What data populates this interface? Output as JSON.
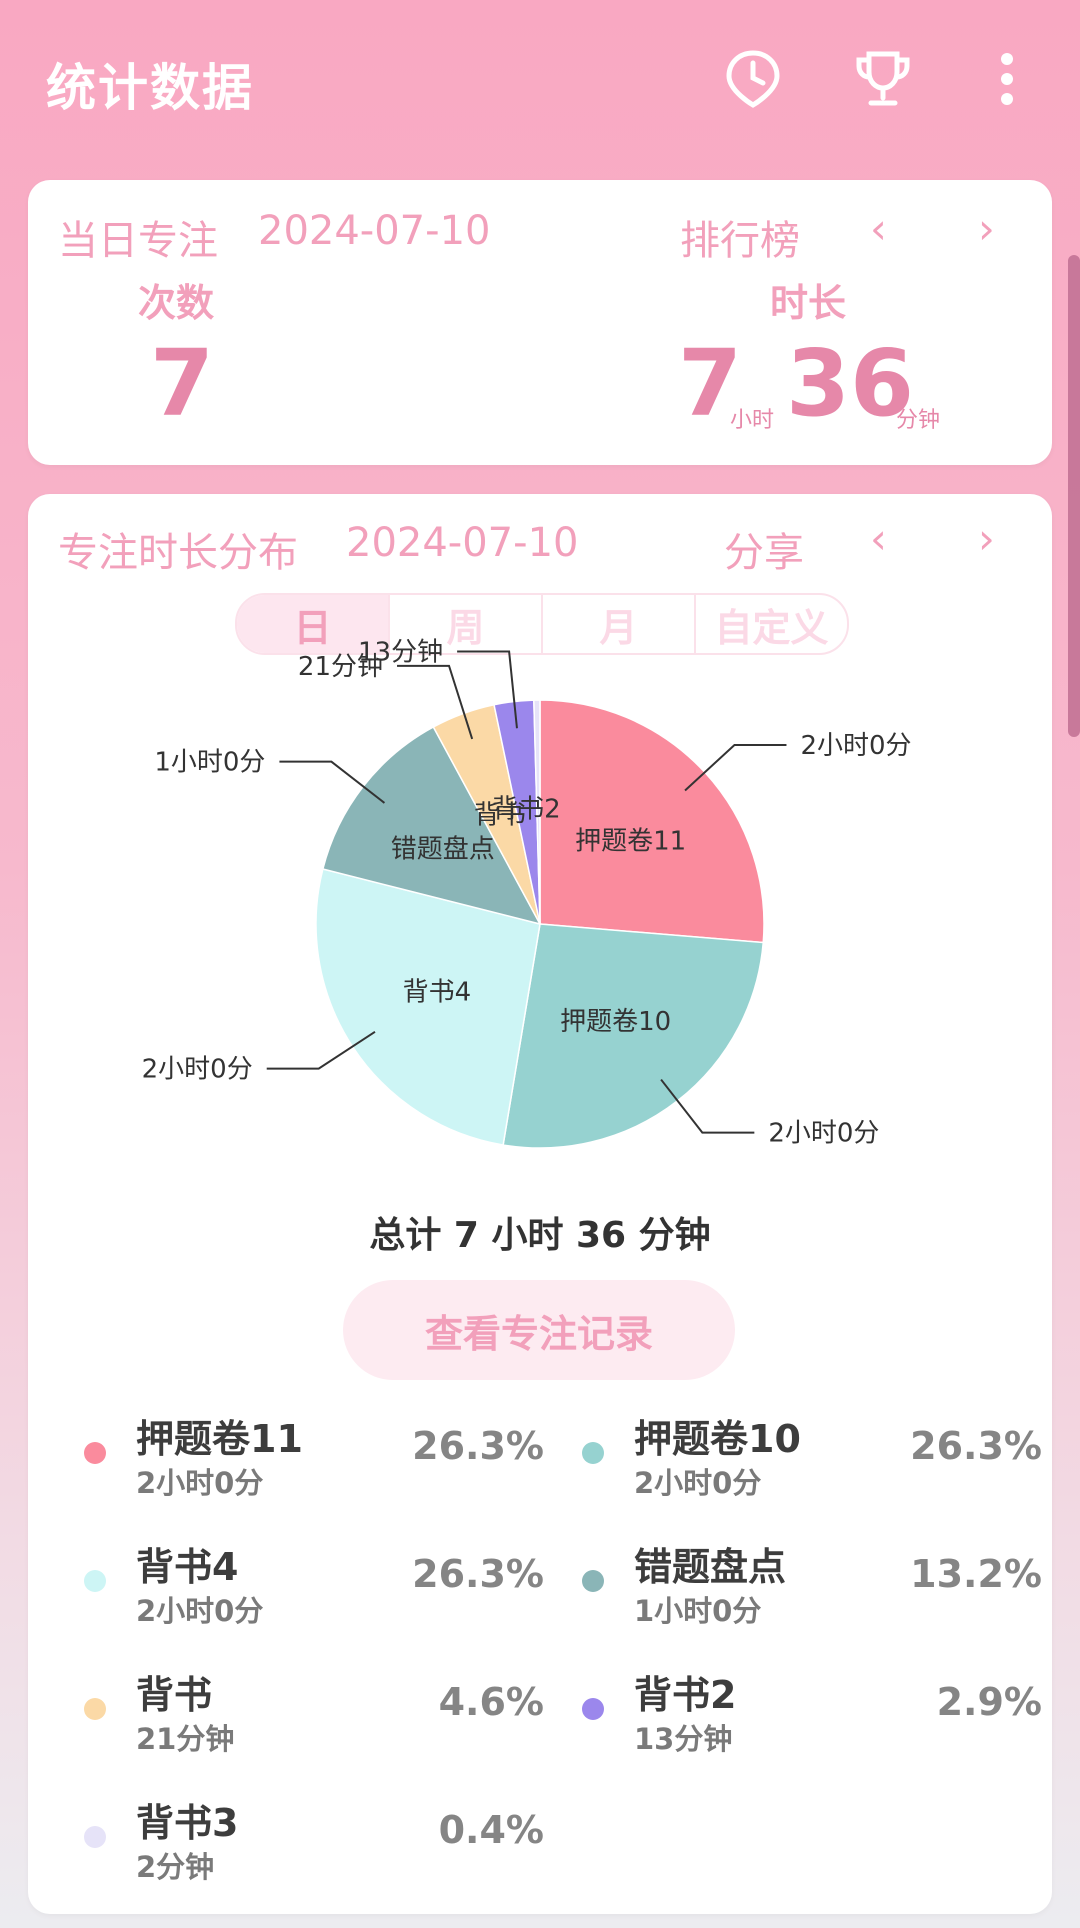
{
  "app": {
    "title": "统计数据"
  },
  "daily": {
    "label": "当日专注",
    "date": "2024-07-10",
    "ranking_label": "排行榜",
    "count_label": "次数",
    "count_value": "7",
    "duration_label": "时长",
    "hours_value": "7",
    "hours_unit": "小时",
    "minutes_value": "36",
    "minutes_unit": "分钟"
  },
  "distribution": {
    "label": "专注时长分布",
    "date": "2024-07-10",
    "share_label": "分享",
    "tabs": [
      "日",
      "周",
      "月",
      "自定义"
    ],
    "selected_tab": "日",
    "total_text": "总计 7 小时 36 分钟",
    "record_button": "查看专注记录"
  },
  "chart_data": {
    "type": "pie",
    "total_minutes": 456,
    "slices": [
      {
        "name": "押题卷11",
        "minutes": 120,
        "duration": "2小时0分",
        "percent": "26.3%",
        "color": "#fa8b9d"
      },
      {
        "name": "押题卷10",
        "minutes": 120,
        "duration": "2小时0分",
        "percent": "26.3%",
        "color": "#96d2d0"
      },
      {
        "name": "背书4",
        "minutes": 120,
        "duration": "2小时0分",
        "percent": "26.3%",
        "color": "#cdf5f5"
      },
      {
        "name": "错题盘点",
        "minutes": 60,
        "duration": "1小时0分",
        "percent": "13.2%",
        "color": "#8ab5b7"
      },
      {
        "name": "背书",
        "minutes": 21,
        "duration": "21分钟",
        "percent": "4.6%",
        "color": "#fbd9a6"
      },
      {
        "name": "背书2",
        "minutes": 13,
        "duration": "13分钟",
        "percent": "2.9%",
        "color": "#9b87ec"
      },
      {
        "name": "背书3",
        "minutes": 2,
        "duration": "2分钟",
        "percent": "0.4%",
        "color": "#e6e3f8"
      }
    ]
  },
  "colors": {
    "accent": "#f2a0bb",
    "value_pink": "#e688a9"
  }
}
